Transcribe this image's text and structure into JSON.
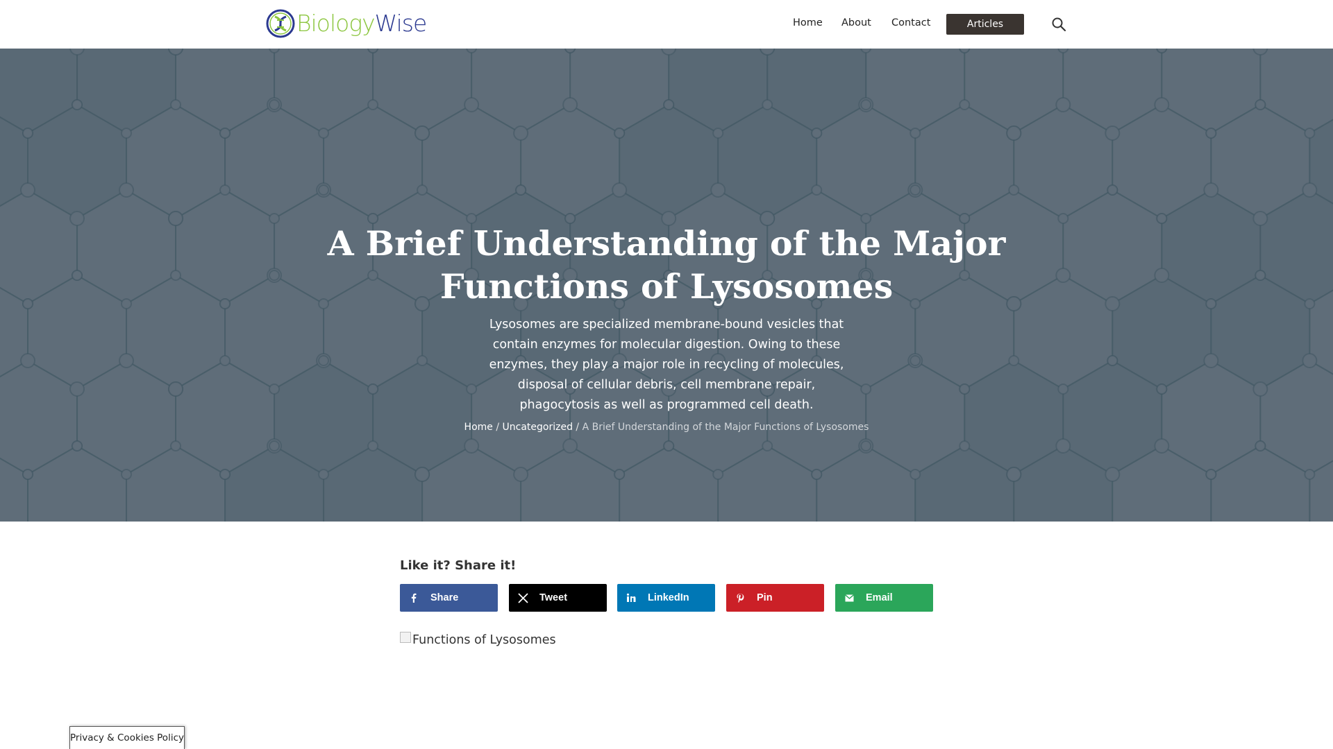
{
  "header": {
    "logo_part1": "Biology",
    "logo_part2": "Wise",
    "nav": [
      {
        "label": "Home"
      },
      {
        "label": "About"
      },
      {
        "label": "Contact"
      },
      {
        "label": "Articles"
      }
    ],
    "search_icon": "search-icon"
  },
  "hero": {
    "title": "A Brief Understanding of the Major Functions of Lysosomes",
    "summary": "Lysosomes are specialized membrane-bound vesicles that contain enzymes for molecular digestion. Owing to these enzymes, they play a major role in recycling of molecules, disposal of cellular debris, cell membrane repair, phagocytosis as well as programmed cell death.",
    "breadcrumb": {
      "home": "Home",
      "separator": "/",
      "category": "Uncategorized",
      "current": "A Brief Understanding of the Major Functions of Lysosomes"
    }
  },
  "share": {
    "heading": "Like it? Share it!",
    "buttons": [
      {
        "label": "Share",
        "icon": "facebook-icon",
        "color": "#3b5998"
      },
      {
        "label": "Tweet",
        "icon": "x-icon",
        "color": "#000000"
      },
      {
        "label": "LinkedIn",
        "icon": "linkedin-icon",
        "color": "#0077b5"
      },
      {
        "label": "Pin",
        "icon": "pinterest-icon",
        "color": "#cb2027"
      },
      {
        "label": "Email",
        "icon": "email-icon",
        "color": "#2ba65a"
      }
    ]
  },
  "article": {
    "image_alt": "Functions of Lysosomes"
  },
  "footer": {
    "privacy_label": "Privacy & Cookies Policy"
  },
  "colors": {
    "hero_overlay": "#5f6d79",
    "articles_button": "#3a3430",
    "logo_green": "#8cc63f",
    "logo_blue": "#2b3990"
  }
}
